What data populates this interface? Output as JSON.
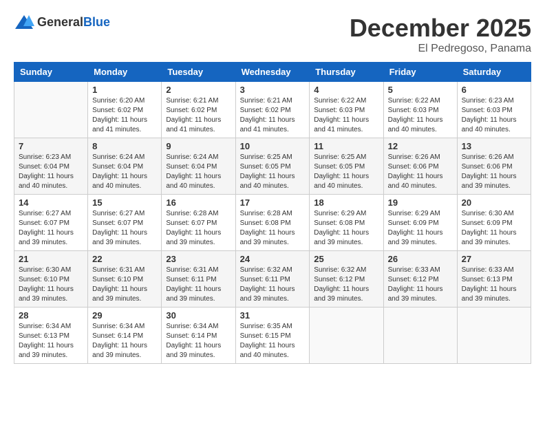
{
  "header": {
    "logo_general": "General",
    "logo_blue": "Blue",
    "month": "December 2025",
    "location": "El Pedregoso, Panama"
  },
  "calendar": {
    "days_of_week": [
      "Sunday",
      "Monday",
      "Tuesday",
      "Wednesday",
      "Thursday",
      "Friday",
      "Saturday"
    ],
    "weeks": [
      [
        {
          "day": "",
          "info": ""
        },
        {
          "day": "1",
          "info": "Sunrise: 6:20 AM\nSunset: 6:02 PM\nDaylight: 11 hours\nand 41 minutes."
        },
        {
          "day": "2",
          "info": "Sunrise: 6:21 AM\nSunset: 6:02 PM\nDaylight: 11 hours\nand 41 minutes."
        },
        {
          "day": "3",
          "info": "Sunrise: 6:21 AM\nSunset: 6:02 PM\nDaylight: 11 hours\nand 41 minutes."
        },
        {
          "day": "4",
          "info": "Sunrise: 6:22 AM\nSunset: 6:03 PM\nDaylight: 11 hours\nand 41 minutes."
        },
        {
          "day": "5",
          "info": "Sunrise: 6:22 AM\nSunset: 6:03 PM\nDaylight: 11 hours\nand 40 minutes."
        },
        {
          "day": "6",
          "info": "Sunrise: 6:23 AM\nSunset: 6:03 PM\nDaylight: 11 hours\nand 40 minutes."
        }
      ],
      [
        {
          "day": "7",
          "info": "Sunrise: 6:23 AM\nSunset: 6:04 PM\nDaylight: 11 hours\nand 40 minutes."
        },
        {
          "day": "8",
          "info": "Sunrise: 6:24 AM\nSunset: 6:04 PM\nDaylight: 11 hours\nand 40 minutes."
        },
        {
          "day": "9",
          "info": "Sunrise: 6:24 AM\nSunset: 6:04 PM\nDaylight: 11 hours\nand 40 minutes."
        },
        {
          "day": "10",
          "info": "Sunrise: 6:25 AM\nSunset: 6:05 PM\nDaylight: 11 hours\nand 40 minutes."
        },
        {
          "day": "11",
          "info": "Sunrise: 6:25 AM\nSunset: 6:05 PM\nDaylight: 11 hours\nand 40 minutes."
        },
        {
          "day": "12",
          "info": "Sunrise: 6:26 AM\nSunset: 6:06 PM\nDaylight: 11 hours\nand 40 minutes."
        },
        {
          "day": "13",
          "info": "Sunrise: 6:26 AM\nSunset: 6:06 PM\nDaylight: 11 hours\nand 39 minutes."
        }
      ],
      [
        {
          "day": "14",
          "info": "Sunrise: 6:27 AM\nSunset: 6:07 PM\nDaylight: 11 hours\nand 39 minutes."
        },
        {
          "day": "15",
          "info": "Sunrise: 6:27 AM\nSunset: 6:07 PM\nDaylight: 11 hours\nand 39 minutes."
        },
        {
          "day": "16",
          "info": "Sunrise: 6:28 AM\nSunset: 6:07 PM\nDaylight: 11 hours\nand 39 minutes."
        },
        {
          "day": "17",
          "info": "Sunrise: 6:28 AM\nSunset: 6:08 PM\nDaylight: 11 hours\nand 39 minutes."
        },
        {
          "day": "18",
          "info": "Sunrise: 6:29 AM\nSunset: 6:08 PM\nDaylight: 11 hours\nand 39 minutes."
        },
        {
          "day": "19",
          "info": "Sunrise: 6:29 AM\nSunset: 6:09 PM\nDaylight: 11 hours\nand 39 minutes."
        },
        {
          "day": "20",
          "info": "Sunrise: 6:30 AM\nSunset: 6:09 PM\nDaylight: 11 hours\nand 39 minutes."
        }
      ],
      [
        {
          "day": "21",
          "info": "Sunrise: 6:30 AM\nSunset: 6:10 PM\nDaylight: 11 hours\nand 39 minutes."
        },
        {
          "day": "22",
          "info": "Sunrise: 6:31 AM\nSunset: 6:10 PM\nDaylight: 11 hours\nand 39 minutes."
        },
        {
          "day": "23",
          "info": "Sunrise: 6:31 AM\nSunset: 6:11 PM\nDaylight: 11 hours\nand 39 minutes."
        },
        {
          "day": "24",
          "info": "Sunrise: 6:32 AM\nSunset: 6:11 PM\nDaylight: 11 hours\nand 39 minutes."
        },
        {
          "day": "25",
          "info": "Sunrise: 6:32 AM\nSunset: 6:12 PM\nDaylight: 11 hours\nand 39 minutes."
        },
        {
          "day": "26",
          "info": "Sunrise: 6:33 AM\nSunset: 6:12 PM\nDaylight: 11 hours\nand 39 minutes."
        },
        {
          "day": "27",
          "info": "Sunrise: 6:33 AM\nSunset: 6:13 PM\nDaylight: 11 hours\nand 39 minutes."
        }
      ],
      [
        {
          "day": "28",
          "info": "Sunrise: 6:34 AM\nSunset: 6:13 PM\nDaylight: 11 hours\nand 39 minutes."
        },
        {
          "day": "29",
          "info": "Sunrise: 6:34 AM\nSunset: 6:14 PM\nDaylight: 11 hours\nand 39 minutes."
        },
        {
          "day": "30",
          "info": "Sunrise: 6:34 AM\nSunset: 6:14 PM\nDaylight: 11 hours\nand 39 minutes."
        },
        {
          "day": "31",
          "info": "Sunrise: 6:35 AM\nSunset: 6:15 PM\nDaylight: 11 hours\nand 40 minutes."
        },
        {
          "day": "",
          "info": ""
        },
        {
          "day": "",
          "info": ""
        },
        {
          "day": "",
          "info": ""
        }
      ]
    ]
  }
}
